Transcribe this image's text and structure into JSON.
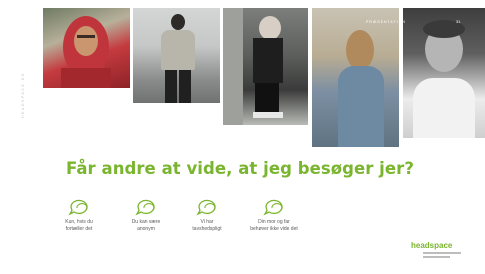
{
  "header": {
    "presentation_label": "PRÆSENTATION",
    "page_number": "31"
  },
  "side_text": "HEADSPACE.DK",
  "headline": "Får andre at vide, at jeg besøger jer?",
  "features": [
    {
      "icon": "chat-icon",
      "label": "Kun, hvis du\nfortæller det"
    },
    {
      "icon": "chat-icon",
      "label": "Du kan være\nanonym"
    },
    {
      "icon": "chat-icon",
      "label": "Vi har\ntavshedspligt"
    },
    {
      "icon": "chat-icon",
      "label": "Din mor og far\nbehøver ikke vide det"
    }
  ],
  "logo": "headspace",
  "colors": {
    "accent": "#7ab52f",
    "text": "#5b5b5b"
  }
}
